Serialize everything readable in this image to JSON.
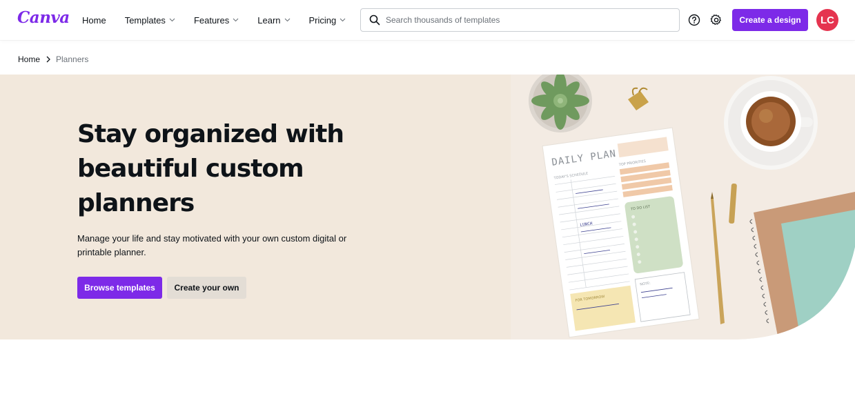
{
  "header": {
    "logo": "Canva",
    "nav": [
      {
        "label": "Home",
        "has_dropdown": false
      },
      {
        "label": "Templates",
        "has_dropdown": true
      },
      {
        "label": "Features",
        "has_dropdown": true
      },
      {
        "label": "Learn",
        "has_dropdown": true
      },
      {
        "label": "Pricing",
        "has_dropdown": true
      }
    ],
    "search_placeholder": "Search thousands of templates",
    "help_icon": "help-circle-icon",
    "settings_icon": "gear-icon",
    "create_button": "Create a design",
    "avatar_initials": "LC"
  },
  "breadcrumb": {
    "home": "Home",
    "current": "Planners"
  },
  "hero": {
    "title": "Stay organized with beautiful custom planners",
    "subtitle": "Manage your life and stay motivated with your own custom digital or printable planner.",
    "primary_button": "Browse templates",
    "secondary_button": "Create your own"
  },
  "planner_art": {
    "heading": "DAILY PLAN",
    "schedule_label": "TODAY'S SCHEDULE",
    "priorities_label": "TOP PRIORITIES",
    "todo_label": "TO DO LIST",
    "tomorrow_label": "FOR TOMORROW",
    "notes_label": "NOTE:",
    "lunch": "LUNCH"
  },
  "colors": {
    "brand_purple": "#7d2ae8",
    "logo_teal": "#20c4cb",
    "avatar_red": "#e5344f",
    "hero_bg": "#f2e8dc"
  }
}
